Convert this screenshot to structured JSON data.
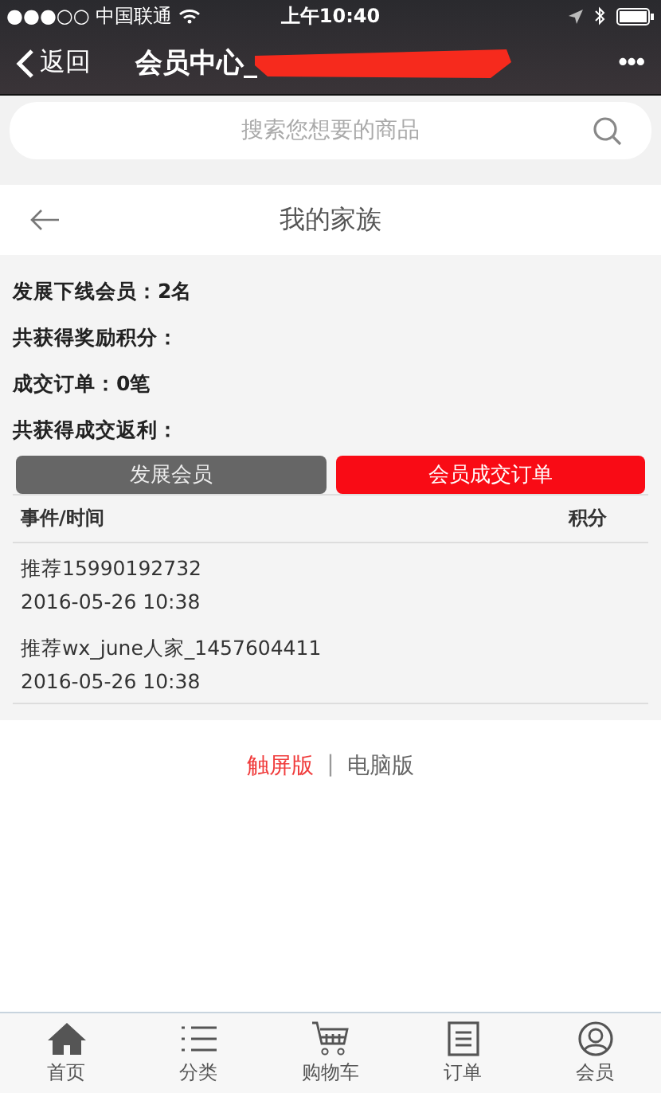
{
  "status_bar": {
    "carrier": "●●●○○ 中国联通",
    "time": "上午10:40"
  },
  "nav": {
    "back": "返回",
    "title": "会员中心_",
    "more": "•••"
  },
  "search": {
    "placeholder": "搜索您想要的商品"
  },
  "header": {
    "title": "我的家族"
  },
  "stats": [
    {
      "label": "发展下线会员：",
      "value": "2名"
    },
    {
      "label": "共获得奖励积分："
    },
    {
      "label": "成交订单：",
      "value": "0笔"
    },
    {
      "label": "共获得成交返利："
    }
  ],
  "tabs": [
    {
      "label": "发展会员",
      "selected": false
    },
    {
      "label": "会员成交订单",
      "selected": true
    }
  ],
  "table": {
    "columns": [
      "事件/时间",
      "积分"
    ],
    "rows": [
      {
        "event": "推荐15990192732",
        "time": "2016-05-26 10:38"
      },
      {
        "event": "推荐wx_june人家_1457604411",
        "time": "2016-05-26 10:38"
      }
    ]
  },
  "footer": {
    "links": [
      {
        "label": "触屏版",
        "selected": true
      },
      {
        "label": "电脑版",
        "selected": false
      }
    ],
    "separator": "|"
  },
  "bottom_nav": [
    {
      "label": "首页",
      "kind": "home"
    },
    {
      "label": "分类",
      "kind": "list"
    },
    {
      "label": "购物车",
      "kind": "cart"
    },
    {
      "label": "订单",
      "kind": "order"
    },
    {
      "label": "会员",
      "kind": "user"
    }
  ]
}
